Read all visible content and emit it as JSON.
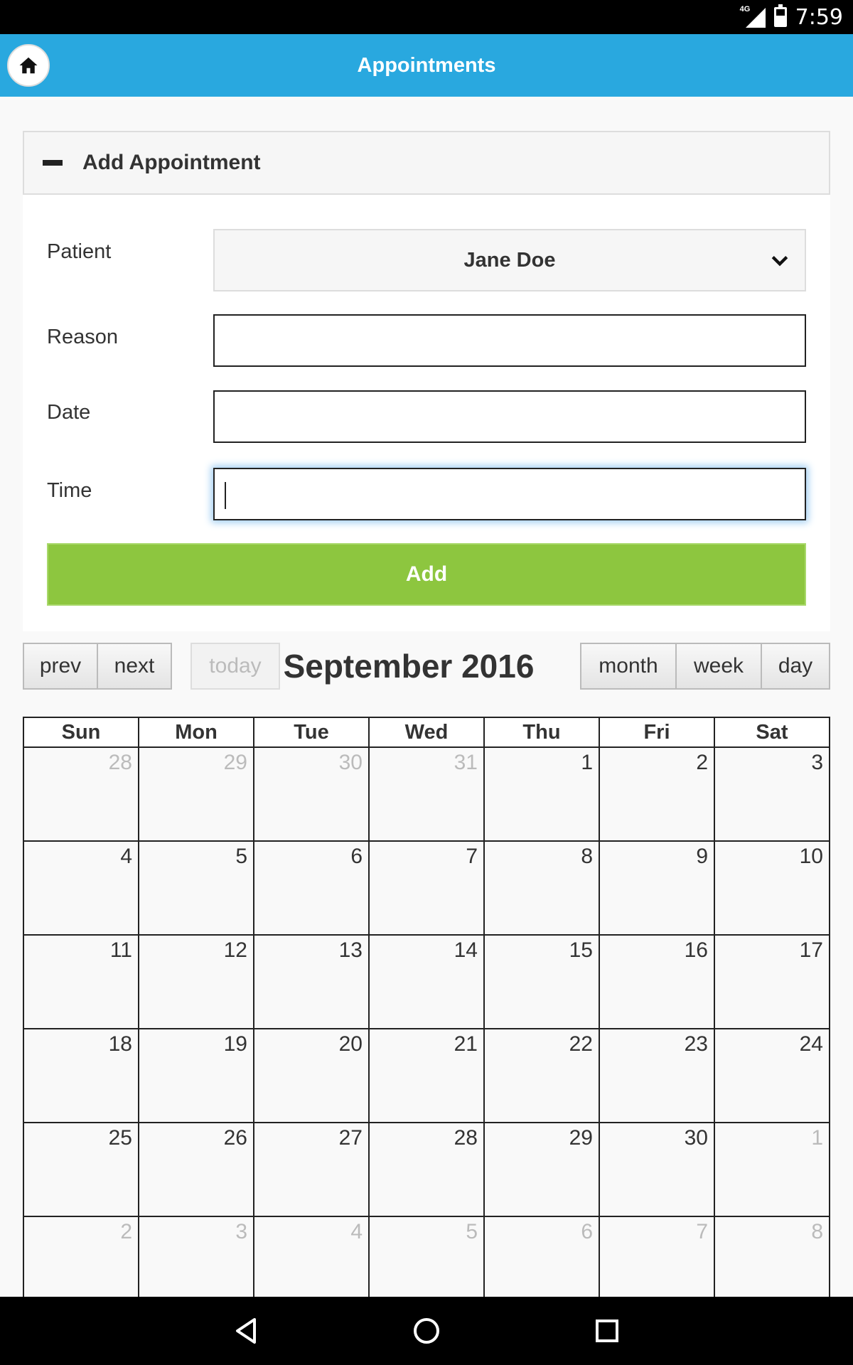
{
  "status_bar": {
    "time": "7:59",
    "network": "4G"
  },
  "app_bar": {
    "title": "Appointments",
    "home_icon": "home-icon"
  },
  "add_panel": {
    "header": "Add Appointment",
    "fields": {
      "patient_label": "Patient",
      "patient_value": "Jane Doe",
      "reason_label": "Reason",
      "reason_value": "",
      "date_label": "Date",
      "date_value": "",
      "time_label": "Time",
      "time_value": ""
    },
    "add_button": "Add",
    "accent": "#8dc63f"
  },
  "calendar": {
    "nav": {
      "prev": "prev",
      "next": "next",
      "today": "today"
    },
    "title": "September 2016",
    "views": {
      "month": "month",
      "week": "week",
      "day": "day"
    },
    "weekdays": [
      "Sun",
      "Mon",
      "Tue",
      "Wed",
      "Thu",
      "Fri",
      "Sat"
    ],
    "weeks": [
      [
        {
          "d": "28",
          "o": true
        },
        {
          "d": "29",
          "o": true
        },
        {
          "d": "30",
          "o": true
        },
        {
          "d": "31",
          "o": true
        },
        {
          "d": "1",
          "o": false
        },
        {
          "d": "2",
          "o": false
        },
        {
          "d": "3",
          "o": false
        }
      ],
      [
        {
          "d": "4",
          "o": false
        },
        {
          "d": "5",
          "o": false
        },
        {
          "d": "6",
          "o": false
        },
        {
          "d": "7",
          "o": false
        },
        {
          "d": "8",
          "o": false
        },
        {
          "d": "9",
          "o": false
        },
        {
          "d": "10",
          "o": false
        }
      ],
      [
        {
          "d": "11",
          "o": false
        },
        {
          "d": "12",
          "o": false
        },
        {
          "d": "13",
          "o": false
        },
        {
          "d": "14",
          "o": false
        },
        {
          "d": "15",
          "o": false
        },
        {
          "d": "16",
          "o": false
        },
        {
          "d": "17",
          "o": false
        }
      ],
      [
        {
          "d": "18",
          "o": false
        },
        {
          "d": "19",
          "o": false
        },
        {
          "d": "20",
          "o": false
        },
        {
          "d": "21",
          "o": false
        },
        {
          "d": "22",
          "o": false
        },
        {
          "d": "23",
          "o": false
        },
        {
          "d": "24",
          "o": false
        }
      ],
      [
        {
          "d": "25",
          "o": false
        },
        {
          "d": "26",
          "o": false
        },
        {
          "d": "27",
          "o": false
        },
        {
          "d": "28",
          "o": false
        },
        {
          "d": "29",
          "o": false
        },
        {
          "d": "30",
          "o": false
        },
        {
          "d": "1",
          "o": true
        }
      ],
      [
        {
          "d": "2",
          "o": true
        },
        {
          "d": "3",
          "o": true
        },
        {
          "d": "4",
          "o": true
        },
        {
          "d": "5",
          "o": true
        },
        {
          "d": "6",
          "o": true
        },
        {
          "d": "7",
          "o": true
        },
        {
          "d": "8",
          "o": true
        }
      ]
    ]
  },
  "colors": {
    "app_bar": "#29a8df",
    "add_button": "#8dc63f"
  }
}
